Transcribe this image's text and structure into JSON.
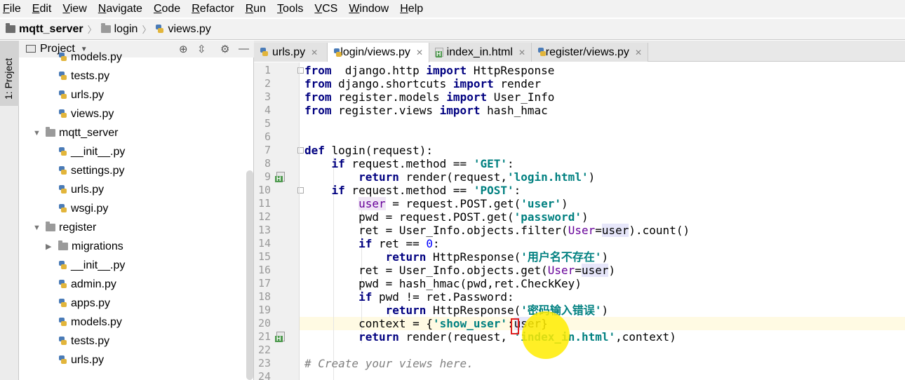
{
  "menu": [
    "File",
    "Edit",
    "View",
    "Navigate",
    "Code",
    "Refactor",
    "Run",
    "Tools",
    "VCS",
    "Window",
    "Help"
  ],
  "breadcrumb": {
    "project": "mqtt_server",
    "folder": "login",
    "file": "views.py"
  },
  "left_strip": {
    "label": "1: Project"
  },
  "project_panel": {
    "title": "Project",
    "tree": [
      {
        "label": "models.py",
        "type": "file",
        "depth": 2
      },
      {
        "label": "tests.py",
        "type": "file",
        "depth": 2
      },
      {
        "label": "urls.py",
        "type": "file",
        "depth": 2
      },
      {
        "label": "views.py",
        "type": "file",
        "depth": 2
      },
      {
        "label": "mqtt_server",
        "type": "folder",
        "depth": 1,
        "expanded": true
      },
      {
        "label": "__init__.py",
        "type": "file",
        "depth": 2
      },
      {
        "label": "settings.py",
        "type": "file",
        "depth": 2
      },
      {
        "label": "urls.py",
        "type": "file",
        "depth": 2
      },
      {
        "label": "wsgi.py",
        "type": "file",
        "depth": 2
      },
      {
        "label": "register",
        "type": "folder",
        "depth": 1,
        "expanded": true
      },
      {
        "label": "migrations",
        "type": "folder",
        "depth": 2,
        "expanded": false
      },
      {
        "label": "__init__.py",
        "type": "file",
        "depth": 2
      },
      {
        "label": "admin.py",
        "type": "file",
        "depth": 2
      },
      {
        "label": "apps.py",
        "type": "file",
        "depth": 2
      },
      {
        "label": "models.py",
        "type": "file",
        "depth": 2
      },
      {
        "label": "tests.py",
        "type": "file",
        "depth": 2
      },
      {
        "label": "urls.py",
        "type": "file",
        "depth": 2
      }
    ]
  },
  "tabs": [
    {
      "label": "urls.py",
      "icon": "python-file-icon",
      "active": false
    },
    {
      "label": "login/views.py",
      "icon": "python-file-icon",
      "active": true
    },
    {
      "label": "index_in.html",
      "icon": "html-file-icon",
      "active": false
    },
    {
      "label": "register/views.py",
      "icon": "python-file-icon",
      "active": false
    }
  ],
  "editor": {
    "current_line": 20,
    "lines": [
      [
        [
          "kw",
          "from"
        ],
        [
          "",
          "  django.http "
        ],
        [
          "kw",
          "import"
        ],
        [
          "",
          " HttpResponse"
        ]
      ],
      [
        [
          "kw",
          "from"
        ],
        [
          "",
          " django.shortcuts "
        ],
        [
          "kw",
          "import"
        ],
        [
          "",
          " render"
        ]
      ],
      [
        [
          "kw",
          "from"
        ],
        [
          "",
          " register.models "
        ],
        [
          "kw",
          "import"
        ],
        [
          "",
          " User_Info"
        ]
      ],
      [
        [
          "kw",
          "from"
        ],
        [
          "",
          " register.views "
        ],
        [
          "kw",
          "import"
        ],
        [
          "",
          " hash_hmac"
        ]
      ],
      [],
      [],
      [
        [
          "kw",
          "def"
        ],
        [
          "",
          " login(request):"
        ]
      ],
      [
        [
          "",
          "    "
        ],
        [
          "kw",
          "if"
        ],
        [
          "",
          " request.method == "
        ],
        [
          "str",
          "'GET'"
        ],
        [
          "",
          ":"
        ]
      ],
      [
        [
          "",
          "        "
        ],
        [
          "kw",
          "return"
        ],
        [
          "",
          " render(request,"
        ],
        [
          "str",
          "'login.html'"
        ],
        [
          "",
          ")"
        ]
      ],
      [
        [
          "",
          "    "
        ],
        [
          "kw",
          "if"
        ],
        [
          "",
          " request.method == "
        ],
        [
          "str",
          "'POST'"
        ],
        [
          "",
          ":"
        ]
      ],
      [
        [
          "",
          "        "
        ],
        [
          "param hl-user",
          "user"
        ],
        [
          "",
          " = request.POST.get("
        ],
        [
          "str",
          "'user'"
        ],
        [
          "",
          ")"
        ]
      ],
      [
        [
          "",
          "        pwd = request.POST.get("
        ],
        [
          "str",
          "'password'"
        ],
        [
          "",
          ")"
        ]
      ],
      [
        [
          "",
          "        ret = User_Info.objects.filter("
        ],
        [
          "param",
          "User"
        ],
        [
          "",
          "="
        ],
        [
          "hl-ref",
          "user"
        ],
        [
          "",
          ").count()"
        ]
      ],
      [
        [
          "",
          "        "
        ],
        [
          "kw",
          "if"
        ],
        [
          "",
          " ret == "
        ],
        [
          "num",
          "0"
        ],
        [
          "",
          ":"
        ]
      ],
      [
        [
          "",
          "            "
        ],
        [
          "kw",
          "return"
        ],
        [
          "",
          " HttpResponse("
        ],
        [
          "str",
          "'用户名不存在'"
        ],
        [
          "",
          ")"
        ]
      ],
      [
        [
          "",
          "        ret = User_Info.objects.get("
        ],
        [
          "param",
          "User"
        ],
        [
          "",
          "="
        ],
        [
          "hl-ref",
          "user"
        ],
        [
          "",
          ")"
        ]
      ],
      [
        [
          "",
          "        pwd = hash_hmac(pwd,ret.CheckKey)"
        ]
      ],
      [
        [
          "",
          "        "
        ],
        [
          "kw",
          "if"
        ],
        [
          "",
          " pwd != ret.Password:"
        ]
      ],
      [
        [
          "",
          "            "
        ],
        [
          "kw",
          "return"
        ],
        [
          "",
          " HttpResponse("
        ],
        [
          "str",
          "'密码输入错误'"
        ],
        [
          "",
          ")"
        ]
      ],
      [
        [
          "",
          "        context = {"
        ],
        [
          "str",
          "'show_user'"
        ],
        [
          "",
          ":"
        ],
        [
          "hl-ref",
          "user"
        ],
        [
          "",
          "}"
        ]
      ],
      [
        [
          "",
          "        "
        ],
        [
          "kw",
          "return"
        ],
        [
          "",
          " render(request, "
        ],
        [
          "str",
          "'index_in.html'"
        ],
        [
          "",
          ",context)"
        ]
      ],
      [],
      [
        [
          "cmt",
          "# Create your views here."
        ]
      ],
      []
    ]
  }
}
